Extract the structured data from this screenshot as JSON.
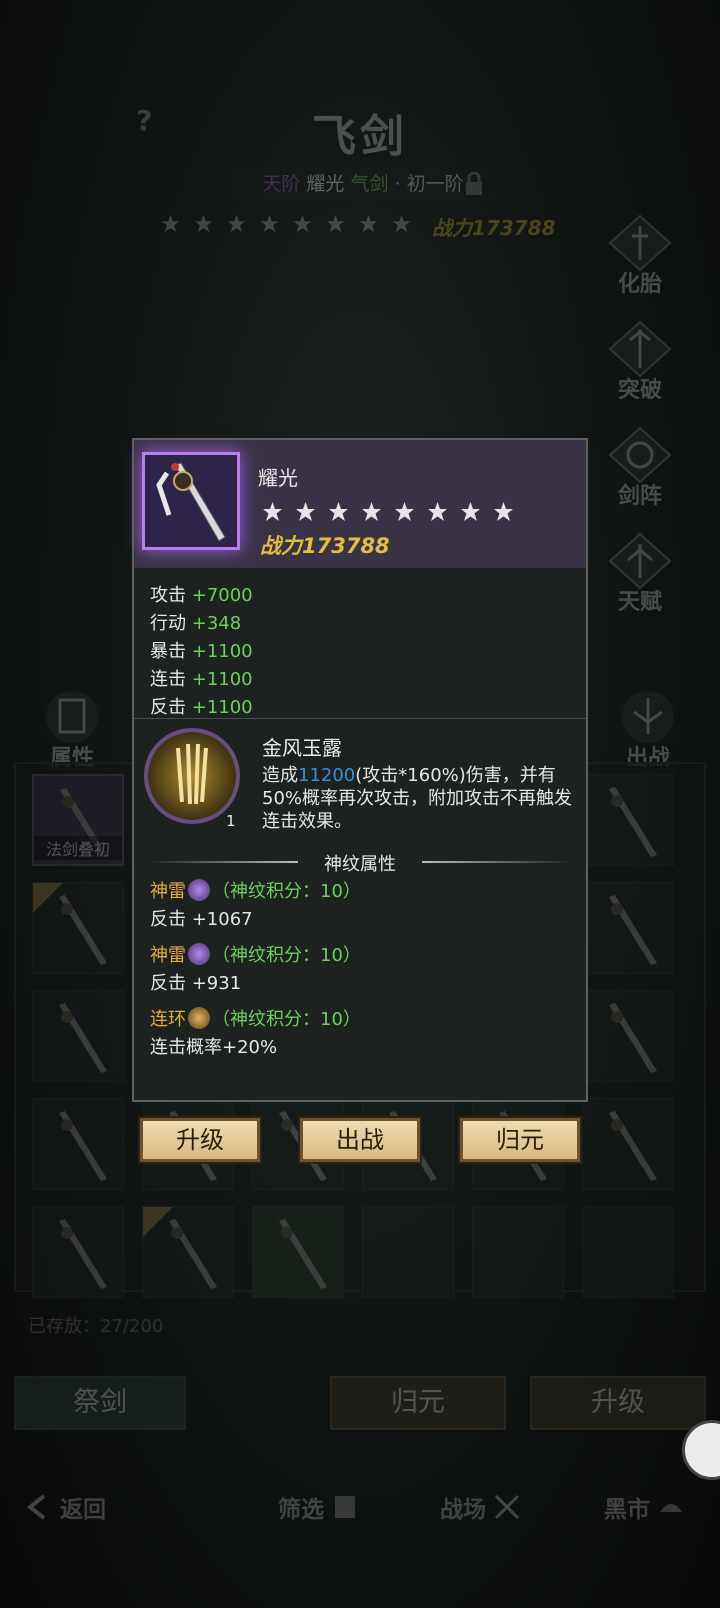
{
  "header": {
    "help": "?",
    "title": "飞剑",
    "rank": {
      "tier": "天阶",
      "name": "耀光",
      "kind": "气剑",
      "separator": "·",
      "stage": "初一阶"
    },
    "star_count": 8,
    "power_label": "战力173788"
  },
  "side_buttons": [
    {
      "label": "化胎"
    },
    {
      "label": "突破"
    },
    {
      "label": "剑阵"
    },
    {
      "label": "天赋"
    }
  ],
  "left_button": {
    "label": "属性"
  },
  "right_button": {
    "label": "出战"
  },
  "grid": {
    "selected_tag": "法剑叠初"
  },
  "storage": {
    "label": "已存放：27/200"
  },
  "bottom_buttons": {
    "sacrifice": "祭剑",
    "return": "归元",
    "upgrade": "升级"
  },
  "nav": {
    "back": "返回",
    "filter": "筛选",
    "battlefield": "战场",
    "black_market": "黑市"
  },
  "popup": {
    "item_name": "耀光",
    "star_count": 8,
    "power_label": "战力173788",
    "stats": [
      {
        "name": "攻击",
        "value": "+7000"
      },
      {
        "name": "行动",
        "value": "+348"
      },
      {
        "name": "暴击",
        "value": "+1100"
      },
      {
        "name": "连击",
        "value": "+1100"
      },
      {
        "name": "反击",
        "value": "+1100"
      }
    ],
    "skill": {
      "name": "金风玉露",
      "level": "1",
      "desc_prefix": "造成",
      "desc_value": "11200",
      "desc_suffix": "(攻击*160%)伤害，并有50%概率再次攻击，附加攻击不再触发连击效果。"
    },
    "rune_title": "神纹属性",
    "runes": [
      {
        "name": "神雷",
        "points": "（神纹积分：10）",
        "effect": "反击 +1067"
      },
      {
        "name": "神雷",
        "points": "（神纹积分：10）",
        "effect": "反击 +931"
      },
      {
        "name": "连环",
        "points": "（神纹积分：10）",
        "effect": "连击概率+20%"
      }
    ],
    "actions": {
      "upgrade": "升级",
      "deploy": "出战",
      "return": "归元"
    }
  },
  "colors": {
    "accent_gold": "#e2bf3f",
    "stat_green": "#6ecf5d",
    "highlight_blue": "#3e8fd1",
    "rune_orange": "#e0ac3a",
    "frame_purple": "#b77ff0"
  }
}
